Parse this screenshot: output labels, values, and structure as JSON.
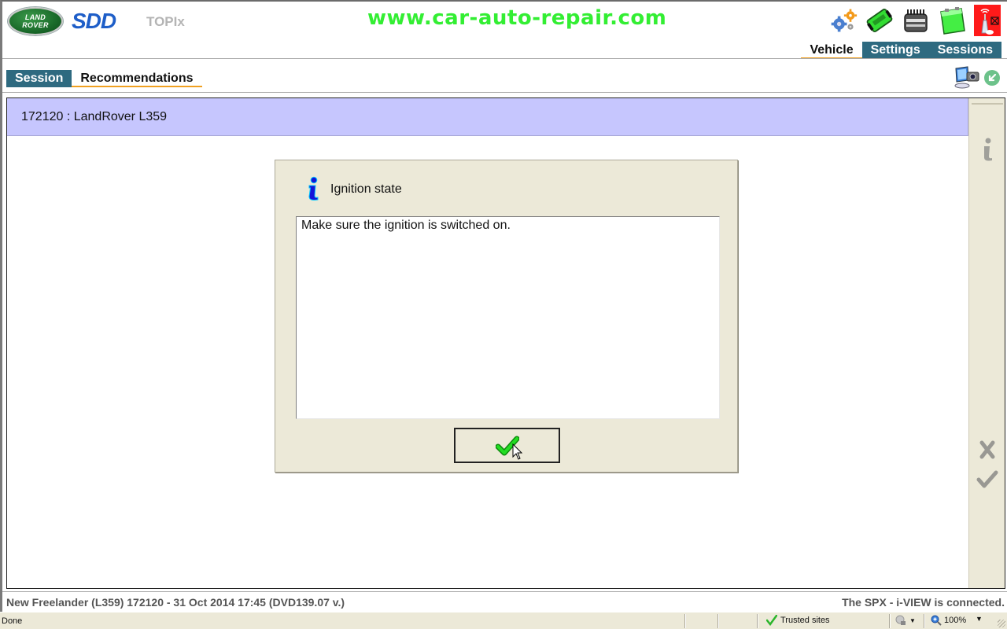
{
  "header": {
    "landrover_logo": [
      "LAND",
      "ROVER"
    ],
    "sdd_logo": "SDD",
    "topix_logo": "TOPIx",
    "watermark": "www.car-auto-repair.com",
    "toolbar_icons": [
      {
        "name": "settings-gears-icon"
      },
      {
        "name": "vci-interface-icon"
      },
      {
        "name": "ecu-module-icon"
      },
      {
        "name": "battery-icon"
      },
      {
        "name": "wireless-disconnected-icon"
      }
    ],
    "main_tabs": [
      {
        "label": "Vehicle",
        "active": true
      },
      {
        "label": "Settings",
        "active": false
      },
      {
        "label": "Sessions",
        "active": false
      }
    ]
  },
  "subnav": {
    "tabs": [
      {
        "label": "Session",
        "active": false
      },
      {
        "label": "Recommendations",
        "active": true
      }
    ],
    "icons": [
      {
        "name": "screenshot-camera-icon"
      },
      {
        "name": "return-arrow-icon"
      }
    ]
  },
  "content": {
    "title": "172120 : LandRover L359",
    "side_icons": [
      "info-icon",
      "cancel-x-icon",
      "confirm-check-icon"
    ]
  },
  "dialog": {
    "title": "Ignition state",
    "message": "Make sure the ignition is switched on.",
    "ok_icon": "green-check-icon"
  },
  "info_bar": {
    "left": "New Freelander (L359) 172120 - 31 Oct 2014 17:45 (DVD139.07 v.)",
    "right": "The SPX - i-VIEW is connected."
  },
  "browser_status": {
    "status": "Done",
    "zone": "Trusted sites",
    "zoom": "100%"
  },
  "colors": {
    "tab_blue": "#2e6a80",
    "tab_active_underline": "#f0a020",
    "title_bar": "#c6c6fe",
    "dialog_bg": "#ece9d8",
    "watermark": "#33ee33"
  }
}
